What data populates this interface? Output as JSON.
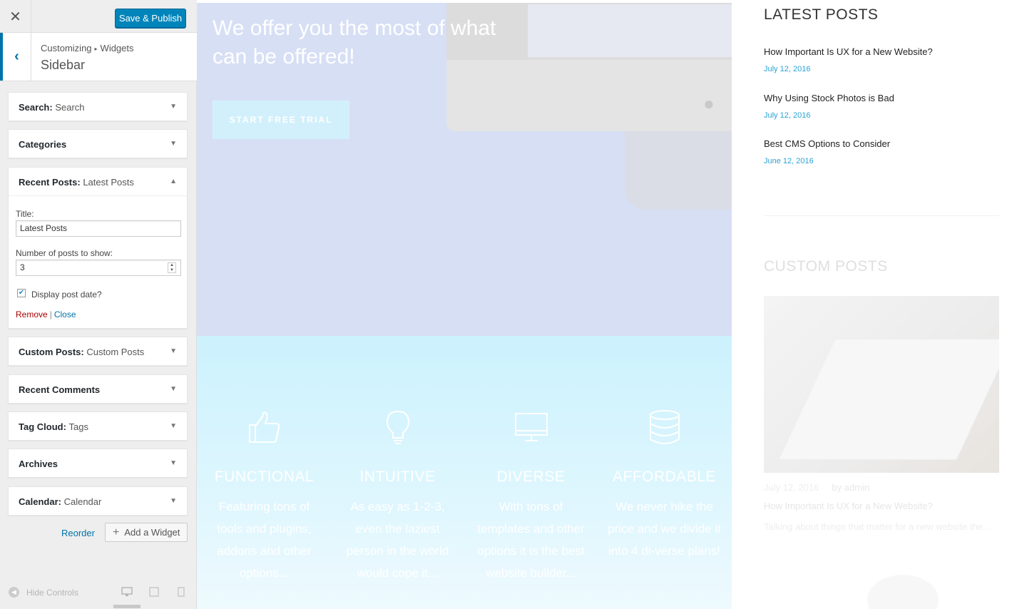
{
  "customizer": {
    "close_symbol": "✕",
    "publish_label": "Save & Publish",
    "back_symbol": "‹",
    "breadcrumb": {
      "root": "Customizing",
      "arrow": "▸",
      "current": "Widgets"
    },
    "section_title": "Sidebar",
    "widgets": [
      {
        "name": "Search:",
        "sub": "Search"
      },
      {
        "name": "Categories",
        "sub": ""
      },
      {
        "name": "Recent Posts:",
        "sub": "Latest Posts"
      },
      {
        "name": "Custom Posts:",
        "sub": "Custom Posts"
      },
      {
        "name": "Recent Comments",
        "sub": ""
      },
      {
        "name": "Tag Cloud:",
        "sub": "Tags"
      },
      {
        "name": "Archives",
        "sub": ""
      },
      {
        "name": "Calendar:",
        "sub": "Calendar"
      }
    ],
    "open_widget": {
      "title_label": "Title:",
      "title_value": "Latest Posts",
      "count_label": "Number of posts to show:",
      "count_value": "3",
      "date_label": "Display post date?",
      "date_checked": true,
      "remove_label": "Remove",
      "separator": "|",
      "close_label": "Close"
    },
    "reorder_label": "Reorder",
    "add_widget_label": "Add a Widget",
    "hide_controls_label": "Hide Controls",
    "caret_down": "▼",
    "caret_up": "▲"
  },
  "preview": {
    "hero_heading": "We offer you the most of what can be offered!",
    "trial_button": "START FREE TRIAL",
    "features": [
      {
        "icon": "thumbs-up-icon",
        "title": "FUNCTIONAL",
        "text": "Featuring tons of tools and plugins, addons and other options..."
      },
      {
        "icon": "lightbulb-icon",
        "title": "INTUITIVE",
        "text": "As easy as 1-2-3, even the laziest person in the world would cope it..."
      },
      {
        "icon": "monitor-icon",
        "title": "DIVERSE",
        "text": "With tons of templates and other options it is the best website builder..."
      },
      {
        "icon": "database-icon",
        "title": "AFFORDABLE",
        "text": "We never hike the price and we divide it into 4 di-verse plans!"
      }
    ],
    "latest_posts_title": "LATEST POSTS",
    "latest_posts": [
      {
        "title": "How Important Is UX for a New Website?",
        "date": "July 12, 2016"
      },
      {
        "title": "Why Using Stock Photos is Bad",
        "date": "July 12, 2016"
      },
      {
        "title": "Best CMS Options to Consider",
        "date": "June 12, 2016"
      }
    ],
    "custom_posts_title": "CUSTOM POSTS",
    "custom_post": {
      "date": "July 12, 2016",
      "author": "by admin",
      "title": "How Important Is UX for a New Website?",
      "excerpt": "Talking about things that matter for a new website the..."
    }
  }
}
